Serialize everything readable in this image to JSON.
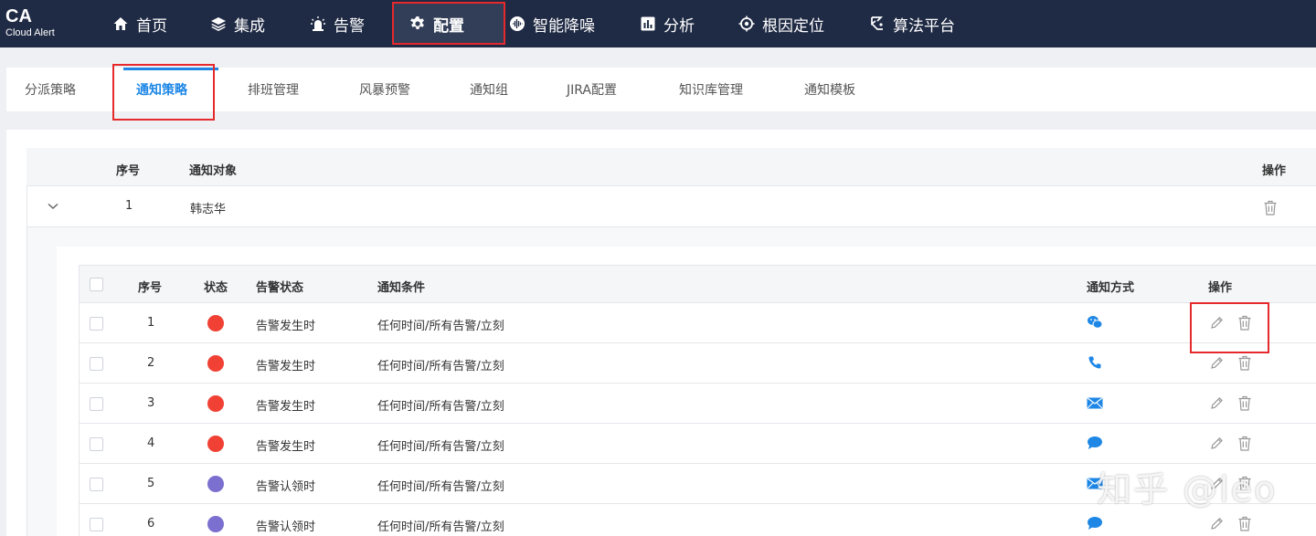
{
  "app": {
    "logo_main": "CA",
    "logo_sub": "Cloud Alert"
  },
  "topnav": {
    "items": [
      {
        "label": "首页",
        "icon": "home-icon"
      },
      {
        "label": "集成",
        "icon": "layers-icon"
      },
      {
        "label": "告警",
        "icon": "alarm-light-icon"
      },
      {
        "label": "配置",
        "icon": "gear-icon",
        "active": true
      },
      {
        "label": "智能降噪",
        "icon": "noise-icon"
      },
      {
        "label": "分析",
        "icon": "bar-chart-icon"
      },
      {
        "label": "根因定位",
        "icon": "target-icon"
      },
      {
        "label": "算法平台",
        "icon": "algorithm-icon"
      }
    ]
  },
  "tabs": [
    {
      "label": "分派策略"
    },
    {
      "label": "通知策略",
      "active": true
    },
    {
      "label": "排班管理"
    },
    {
      "label": "风暴预警"
    },
    {
      "label": "通知组"
    },
    {
      "label": "JIRA配置"
    },
    {
      "label": "知识库管理"
    },
    {
      "label": "通知模板"
    }
  ],
  "outer_table": {
    "headers": {
      "index": "序号",
      "target": "通知对象",
      "actions": "操作"
    },
    "rows": [
      {
        "index": "1",
        "target": "韩志华"
      }
    ]
  },
  "inner_table": {
    "headers": {
      "index": "序号",
      "status": "状态",
      "alert_status": "告警状态",
      "condition": "通知条件",
      "method": "通知方式",
      "actions": "操作"
    },
    "rows": [
      {
        "index": "1",
        "status_color": "#f04134",
        "alert_status": "告警发生时",
        "condition": "任何时间/所有告警/立刻",
        "method_icon": "wechat-icon"
      },
      {
        "index": "2",
        "status_color": "#f04134",
        "alert_status": "告警发生时",
        "condition": "任何时间/所有告警/立刻",
        "method_icon": "phone-icon"
      },
      {
        "index": "3",
        "status_color": "#f04134",
        "alert_status": "告警发生时",
        "condition": "任何时间/所有告警/立刻",
        "method_icon": "email-icon"
      },
      {
        "index": "4",
        "status_color": "#f04134",
        "alert_status": "告警发生时",
        "condition": "任何时间/所有告警/立刻",
        "method_icon": "chat-bubble-icon"
      },
      {
        "index": "5",
        "status_color": "#7b6fd0",
        "alert_status": "告警认领时",
        "condition": "任何时间/所有告警/立刻",
        "method_icon": "email-icon"
      },
      {
        "index": "6",
        "status_color": "#7b6fd0",
        "alert_status": "告警认领时",
        "condition": "任何时间/所有告警/立刻",
        "method_icon": "chat-bubble-icon"
      }
    ]
  },
  "colors": {
    "nav_bg": "#1f2a44",
    "accent": "#1e87e6",
    "highlight_box": "#e5292c",
    "status_red": "#f04134",
    "status_purple": "#7b6fd0"
  },
  "watermark": "知乎 @leo"
}
